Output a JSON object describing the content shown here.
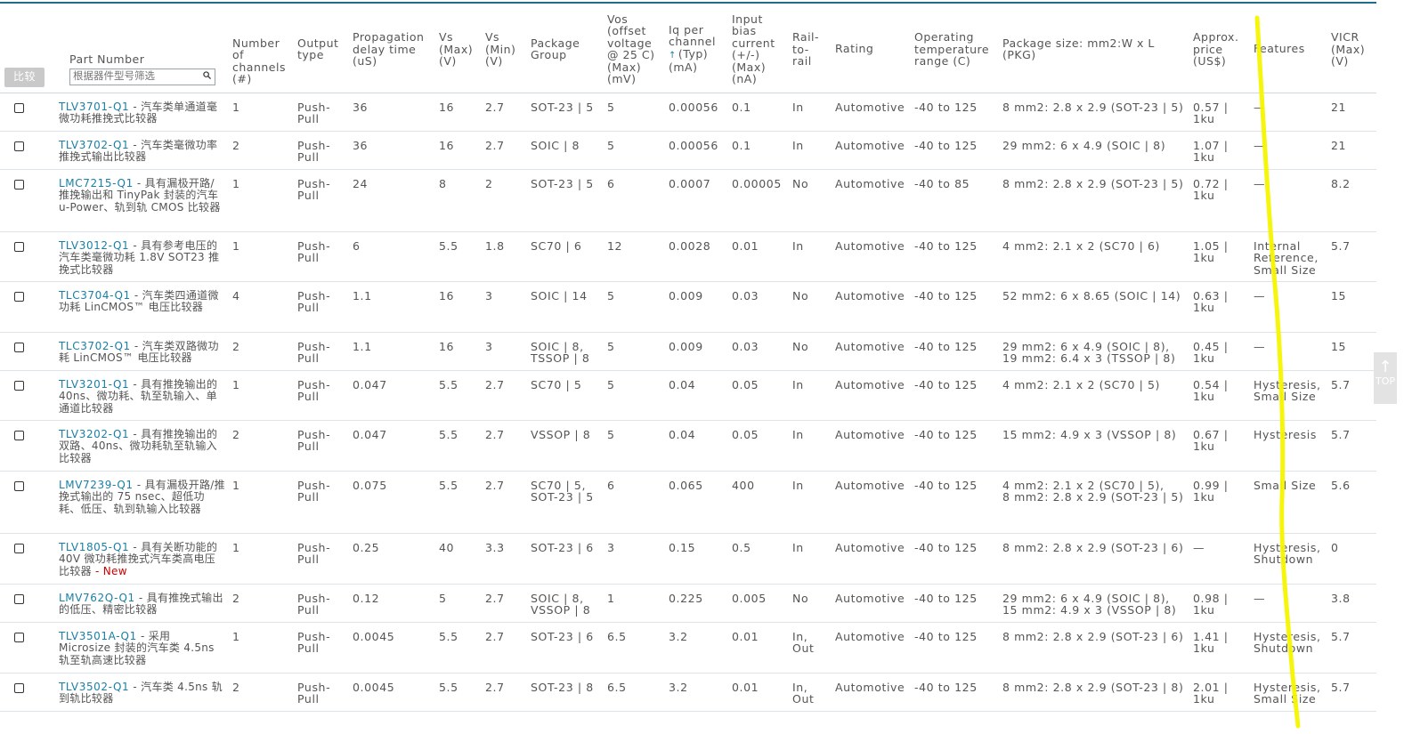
{
  "compare_button": "比较",
  "filter": {
    "placeholder": "根据器件型号筛选"
  },
  "headers": {
    "part_number": "Part Number",
    "channels": [
      "Number",
      "of",
      "channels",
      "(#)"
    ],
    "output": [
      "Output",
      "type"
    ],
    "prop": [
      "Propagation",
      "delay time",
      "(uS)"
    ],
    "vsmax": [
      "Vs",
      "(Max)",
      "(V)"
    ],
    "vsmin": [
      "Vs",
      "(Min)",
      "(V)"
    ],
    "package": [
      "Package",
      "Group"
    ],
    "vos": [
      "Vos",
      "(offset",
      "voltage",
      "@ 25 C)",
      "(Max)",
      "(mV)"
    ],
    "iq": [
      "Iq per",
      "channel",
      "(Typ)",
      "(mA)"
    ],
    "ib": [
      "Input",
      "bias",
      "current",
      "(+/-)",
      "(Max)",
      "(nA)"
    ],
    "rail": [
      "Rail-",
      "to-",
      "rail"
    ],
    "rating": "Rating",
    "temp": [
      "Operating",
      "temperature",
      "range (C)"
    ],
    "pkgsize": [
      "Package size: mm2:W x L",
      "(PKG)"
    ],
    "price": [
      "Approx.",
      "price",
      "(US$)"
    ],
    "features": "Features",
    "vicr": [
      "VICR",
      "(Max)",
      "(V)"
    ]
  },
  "rows": [
    {
      "part": "TLV3701-Q1",
      "desc": " - 汽车类单通道毫微功耗推挽式比较器",
      "new": "",
      "ch": "1",
      "out": [
        "Push-",
        "Pull"
      ],
      "prop": "36",
      "vsmax": "16",
      "vsmin": "2.7",
      "pkg": [
        "SOT-23 | 5"
      ],
      "vos": "5",
      "iq": "0.00056",
      "ib": "0.1",
      "rail": [
        "In"
      ],
      "rating": "Automotive",
      "temp": "-40 to 125",
      "size": [
        "8 mm2: 2.8 x 2.9 (SOT-23 | 5)"
      ],
      "price": [
        "0.57 |",
        "1ku"
      ],
      "feat": [
        "—"
      ],
      "vicr": "21"
    },
    {
      "part": "TLV3702-Q1",
      "desc": " - 汽车类毫微功率推挽式输出比较器",
      "new": "",
      "ch": "2",
      "out": [
        "Push-",
        "Pull"
      ],
      "prop": "36",
      "vsmax": "16",
      "vsmin": "2.7",
      "pkg": [
        "SOIC | 8"
      ],
      "vos": "5",
      "iq": "0.00056",
      "ib": "0.1",
      "rail": [
        "In"
      ],
      "rating": "Automotive",
      "temp": "-40 to 125",
      "size": [
        "29 mm2: 6 x 4.9 (SOIC | 8)"
      ],
      "price": [
        "1.07 |",
        "1ku"
      ],
      "feat": [
        "—"
      ],
      "vicr": "21"
    },
    {
      "part": "LMC7215-Q1",
      "desc": " - 具有漏极开路/推挽输出和 TinyPak 封装的汽车 u-Power、轨到轨 CMOS 比较器",
      "new": "",
      "ch": "1",
      "out": [
        "Push-",
        "Pull"
      ],
      "prop": "24",
      "vsmax": "8",
      "vsmin": "2",
      "pkg": [
        "SOT-23 | 5"
      ],
      "vos": "6",
      "iq": "0.0007",
      "ib": "0.00005",
      "rail": [
        "No"
      ],
      "rating": "Automotive",
      "temp": "-40 to 85",
      "size": [
        "8 mm2: 2.8 x 2.9 (SOT-23 | 5)"
      ],
      "price": [
        "0.72 |",
        "1ku"
      ],
      "feat": [
        "—"
      ],
      "vicr": "8.2"
    },
    {
      "part": "TLV3012-Q1",
      "desc": " - 具有参考电压的汽车类毫微功耗 1.8V SOT23 推挽式比较器",
      "new": "",
      "ch": "1",
      "out": [
        "Push-",
        "Pull"
      ],
      "prop": "6",
      "vsmax": "5.5",
      "vsmin": "1.8",
      "pkg": [
        "SC70 | 6"
      ],
      "vos": "12",
      "iq": "0.0028",
      "ib": "0.01",
      "rail": [
        "In"
      ],
      "rating": "Automotive",
      "temp": "-40 to 125",
      "size": [
        "4 mm2: 2.1 x 2 (SC70 | 6)"
      ],
      "price": [
        "1.05 |",
        "1ku"
      ],
      "feat": [
        "Internal",
        "Reference,",
        "Small Size"
      ],
      "vicr": "5.7"
    },
    {
      "part": "TLC3704-Q1",
      "desc": " - 汽车类四通道微功耗 LinCMOS™ 电压比较器",
      "new": "",
      "ch": "4",
      "out": [
        "Push-",
        "Pull"
      ],
      "prop": "1.1",
      "vsmax": "16",
      "vsmin": "3",
      "pkg": [
        "SOIC | 14"
      ],
      "vos": "5",
      "iq": "0.009",
      "ib": "0.03",
      "rail": [
        "No"
      ],
      "rating": "Automotive",
      "temp": "-40 to 125",
      "size": [
        "52 mm2: 6 x 8.65 (SOIC | 14)"
      ],
      "price": [
        "0.63 |",
        "1ku"
      ],
      "feat": [
        "—"
      ],
      "vicr": "15"
    },
    {
      "part": "TLC3702-Q1",
      "desc": " - 汽车类双路微功耗 LinCMOS™ 电压比较器",
      "new": "",
      "ch": "2",
      "out": [
        "Push-",
        "Pull"
      ],
      "prop": "1.1",
      "vsmax": "16",
      "vsmin": "3",
      "pkg": [
        "SOIC | 8,",
        "TSSOP | 8"
      ],
      "vos": "5",
      "iq": "0.009",
      "ib": "0.03",
      "rail": [
        "No"
      ],
      "rating": "Automotive",
      "temp": "-40 to 125",
      "size": [
        "29 mm2: 6 x 4.9 (SOIC | 8),",
        "19 mm2: 6.4 x 3 (TSSOP | 8)"
      ],
      "price": [
        "0.45 |",
        "1ku"
      ],
      "feat": [
        "—"
      ],
      "vicr": "15"
    },
    {
      "part": "TLV3201-Q1",
      "desc": " - 具有推挽输出的 40ns、微功耗、轨至轨输入、单通道比较器",
      "new": "",
      "ch": "1",
      "out": [
        "Push-",
        "Pull"
      ],
      "prop": "0.047",
      "vsmax": "5.5",
      "vsmin": "2.7",
      "pkg": [
        "SC70 | 5"
      ],
      "vos": "5",
      "iq": "0.04",
      "ib": "0.05",
      "rail": [
        "In"
      ],
      "rating": "Automotive",
      "temp": "-40 to 125",
      "size": [
        "4 mm2: 2.1 x 2 (SC70 | 5)"
      ],
      "price": [
        "0.54 |",
        "1ku"
      ],
      "feat": [
        "Hysteresis,",
        "Small Size"
      ],
      "vicr": "5.7"
    },
    {
      "part": "TLV3202-Q1",
      "desc": " - 具有推挽输出的双路、40ns、微功耗轨至轨输入比较器",
      "new": "",
      "ch": "2",
      "out": [
        "Push-",
        "Pull"
      ],
      "prop": "0.047",
      "vsmax": "5.5",
      "vsmin": "2.7",
      "pkg": [
        "VSSOP | 8"
      ],
      "vos": "5",
      "iq": "0.04",
      "ib": "0.05",
      "rail": [
        "In"
      ],
      "rating": "Automotive",
      "temp": "-40 to 125",
      "size": [
        "15 mm2: 4.9 x 3 (VSSOP | 8)"
      ],
      "price": [
        "0.67 |",
        "1ku"
      ],
      "feat": [
        "Hysteresis"
      ],
      "vicr": "5.7"
    },
    {
      "part": "LMV7239-Q1",
      "desc": " - 具有漏极开路/推挽式输出的 75 nsec、超低功耗、低压、轨到轨输入比较器",
      "new": "",
      "ch": "1",
      "out": [
        "Push-",
        "Pull"
      ],
      "prop": "0.075",
      "vsmax": "5.5",
      "vsmin": "2.7",
      "pkg": [
        "SC70 | 5,",
        "SOT-23 | 5"
      ],
      "vos": "6",
      "iq": "0.065",
      "ib": "400",
      "rail": [
        "In"
      ],
      "rating": "Automotive",
      "temp": "-40 to 125",
      "size": [
        "4 mm2: 2.1 x 2 (SC70 | 5),",
        "8 mm2: 2.8 x 2.9 (SOT-23 | 5)"
      ],
      "price": [
        "0.99 |",
        "1ku"
      ],
      "feat": [
        "Small Size"
      ],
      "vicr": "5.6"
    },
    {
      "part": "TLV1805-Q1",
      "desc": " - 具有关断功能的 40V 微功耗推挽式汽车类高电压比较器",
      "new": " - New",
      "ch": "1",
      "out": [
        "Push-",
        "Pull"
      ],
      "prop": "0.25",
      "vsmax": "40",
      "vsmin": "3.3",
      "pkg": [
        "SOT-23 | 6"
      ],
      "vos": "3",
      "iq": "0.15",
      "ib": "0.5",
      "rail": [
        "In"
      ],
      "rating": "Automotive",
      "temp": "-40 to 125",
      "size": [
        "8 mm2: 2.8 x 2.9 (SOT-23 | 6)"
      ],
      "price": [
        "—",
        ""
      ],
      "feat": [
        "Hysteresis,",
        "Shutdown"
      ],
      "vicr": "0"
    },
    {
      "part": "LMV762Q-Q1",
      "desc": " - 具有推挽式输出的低压、精密比较器",
      "new": "",
      "ch": "2",
      "out": [
        "Push-",
        "Pull"
      ],
      "prop": "0.12",
      "vsmax": "5",
      "vsmin": "2.7",
      "pkg": [
        "SOIC | 8,",
        "VSSOP | 8"
      ],
      "vos": "1",
      "iq": "0.225",
      "ib": "0.005",
      "rail": [
        "No"
      ],
      "rating": "Automotive",
      "temp": "-40 to 125",
      "size": [
        "29 mm2: 6 x 4.9 (SOIC | 8),",
        "15 mm2: 4.9 x 3 (VSSOP | 8)"
      ],
      "price": [
        "0.98 |",
        "1ku"
      ],
      "feat": [
        "—"
      ],
      "vicr": "3.8"
    },
    {
      "part": "TLV3501A-Q1",
      "desc": " - 采用 Microsize 封装的汽车类 4.5ns 轨至轨高速比较器",
      "new": "",
      "ch": "1",
      "out": [
        "Push-",
        "Pull"
      ],
      "prop": "0.0045",
      "vsmax": "5.5",
      "vsmin": "2.7",
      "pkg": [
        "SOT-23 | 6"
      ],
      "vos": "6.5",
      "iq": "3.2",
      "ib": "0.01",
      "rail": [
        "In,",
        "Out"
      ],
      "rating": "Automotive",
      "temp": "-40 to 125",
      "size": [
        "8 mm2: 2.8 x 2.9 (SOT-23 | 6)"
      ],
      "price": [
        "1.41 |",
        "1ku"
      ],
      "feat": [
        "Hysteresis,",
        "Shutdown"
      ],
      "vicr": "5.7"
    },
    {
      "part": "TLV3502-Q1",
      "desc": " - 汽车类 4.5ns 轨到轨比较器",
      "new": "",
      "ch": "2",
      "out": [
        "Push-",
        "Pull"
      ],
      "prop": "0.0045",
      "vsmax": "5.5",
      "vsmin": "2.7",
      "pkg": [
        "SOT-23 | 8"
      ],
      "vos": "6.5",
      "iq": "3.2",
      "ib": "0.01",
      "rail": [
        "In,",
        "Out"
      ],
      "rating": "Automotive",
      "temp": "-40 to 125",
      "size": [
        "8 mm2: 2.8 x 2.9 (SOT-23 | 8)"
      ],
      "price": [
        "2.01 |",
        "1ku"
      ],
      "feat": [
        "Hysteresis,",
        "Small Size"
      ],
      "vicr": "5.7"
    }
  ],
  "top_button": "TOP",
  "colors": {
    "link": "#1a7fa6",
    "new": "#cc0000",
    "highlight": "#f5f500",
    "header_rule": "#1f6f8b"
  }
}
